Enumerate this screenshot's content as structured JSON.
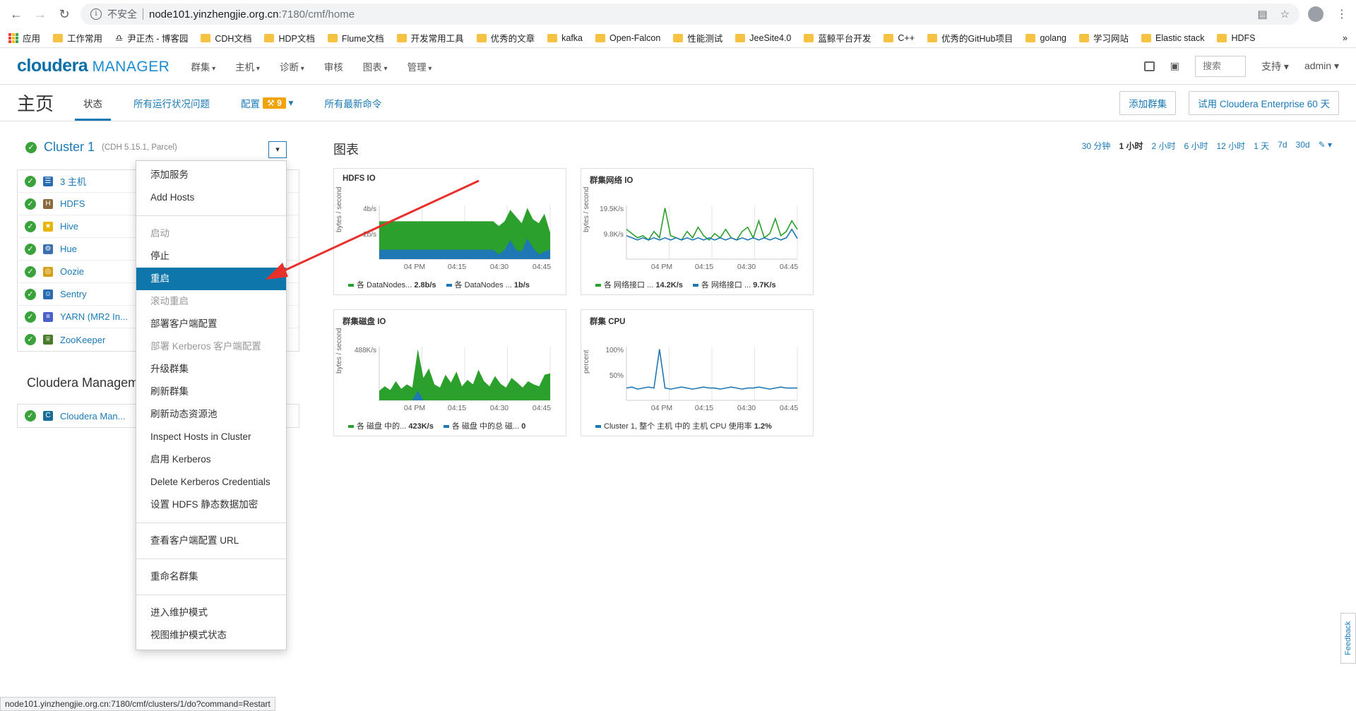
{
  "browser": {
    "insecure_label": "不安全",
    "host": "node101.yinzhengjie.org.cn",
    "path": ":7180/cmf/home",
    "bookmarks": [
      "应用",
      "工作常用",
      "尹正杰 - 博客园",
      "CDH文档",
      "HDP文档",
      "Flume文档",
      "开发常用工具",
      "优秀的文章",
      "kafka",
      "Open-Falcon",
      "性能测试",
      "JeeSite4.0",
      "蓝鲸平台开发",
      "C++",
      "优秀的GitHub项目",
      "golang",
      "学习网站",
      "Elastic stack",
      "HDFS"
    ]
  },
  "nav": {
    "logo_main": "cloudera",
    "logo_sub": "MANAGER",
    "menu": [
      "群集",
      "主机",
      "诊断",
      "审核",
      "图表",
      "管理"
    ],
    "search_placeholder": "搜索",
    "support": "支持",
    "user": "admin"
  },
  "page": {
    "title": "主页",
    "tabs": [
      "状态",
      "所有运行状况问题",
      "配置",
      "所有最新命令"
    ],
    "config_badge": "9",
    "add_cluster": "添加群集",
    "trial": "试用 Cloudera Enterprise 60 天"
  },
  "cluster": {
    "name": "Cluster 1",
    "version": "(CDH 5.15.1, Parcel)",
    "services": [
      "3 主机",
      "HDFS",
      "Hive",
      "Hue",
      "Oozie",
      "Sentry",
      "YARN (MR2 In...",
      "ZooKeeper"
    ]
  },
  "management": {
    "title": "Cloudera Managem",
    "services": [
      "Cloudera Man..."
    ]
  },
  "dropdown": {
    "groups": [
      [
        {
          "label": "添加服务",
          "state": "normal"
        },
        {
          "label": "Add Hosts",
          "state": "normal"
        }
      ],
      [
        {
          "label": "启动",
          "state": "disabled"
        },
        {
          "label": "停止",
          "state": "normal"
        },
        {
          "label": "重启",
          "state": "highlighted"
        },
        {
          "label": "滚动重启",
          "state": "disabled"
        },
        {
          "label": "部署客户端配置",
          "state": "normal"
        },
        {
          "label": "部署 Kerberos 客户端配置",
          "state": "disabled"
        },
        {
          "label": "升级群集",
          "state": "normal"
        },
        {
          "label": "刷新群集",
          "state": "normal"
        },
        {
          "label": "刷新动态资源池",
          "state": "normal"
        },
        {
          "label": "Inspect Hosts in Cluster",
          "state": "normal"
        },
        {
          "label": "启用 Kerberos",
          "state": "normal"
        },
        {
          "label": "Delete Kerberos Credentials",
          "state": "normal"
        },
        {
          "label": "设置 HDFS 静态数据加密",
          "state": "normal"
        }
      ],
      [
        {
          "label": "查看客户端配置 URL",
          "state": "normal"
        }
      ],
      [
        {
          "label": "重命名群集",
          "state": "normal"
        }
      ],
      [
        {
          "label": "进入维护模式",
          "state": "normal"
        },
        {
          "label": "视图维护模式状态",
          "state": "normal"
        }
      ]
    ]
  },
  "charts_section": {
    "title": "图表",
    "time_ranges": [
      "30 分钟",
      "1 小时",
      "2 小时",
      "6 小时",
      "12 小时",
      "1 天",
      "7d",
      "30d"
    ],
    "active_range": "1 小时"
  },
  "chart_data": [
    {
      "type": "area",
      "title": "HDFS IO",
      "ylabel": "bytes / second",
      "yticks": [
        "4b/s",
        "2b/s"
      ],
      "xticks": [
        "04 PM",
        "04:15",
        "04:30",
        "04:45"
      ],
      "series": [
        {
          "name": "各 DataNodes...",
          "color": "#2ca02c",
          "latest": "2.8b/s",
          "values": [
            4,
            4,
            4,
            4,
            4,
            4,
            4,
            4,
            4,
            4,
            4,
            4,
            4,
            4,
            4,
            4,
            4,
            4,
            4,
            4,
            4,
            3.5,
            4,
            5.2,
            4.5,
            3.8,
            5.4,
            4.2,
            3.8,
            4.8,
            2.8
          ]
        },
        {
          "name": "各 DataNodes ...",
          "color": "#1f77b4",
          "latest": "1b/s",
          "values": [
            1,
            1,
            1,
            1,
            1,
            1,
            1,
            1,
            1,
            1,
            1,
            1,
            1,
            1,
            1,
            1,
            1,
            1,
            1,
            1,
            1,
            0.5,
            1,
            2,
            1,
            0.8,
            2.2,
            1.2,
            0.5,
            0.8,
            1
          ]
        }
      ]
    },
    {
      "type": "line",
      "title": "群集网络 IO",
      "ylabel": "bytes / second",
      "yticks": [
        "19.5K/s",
        "9.8K/s"
      ],
      "xticks": [
        "04 PM",
        "04:15",
        "04:30",
        "04:45"
      ],
      "series": [
        {
          "name": "各 网络接口 ...",
          "color": "#2ca02c",
          "latest": "14.2K/s",
          "values": [
            14,
            12,
            10,
            11,
            9,
            13,
            10,
            24,
            11,
            10,
            9,
            13,
            10,
            15,
            11,
            9,
            12,
            10,
            14,
            10,
            9,
            13,
            15,
            10,
            18,
            10,
            12,
            19,
            11,
            13,
            18,
            14
          ]
        },
        {
          "name": "各 网络接口 ...",
          "color": "#1f77b4",
          "latest": "9.7K/s",
          "values": [
            11,
            10,
            9,
            10,
            9,
            10,
            9,
            10,
            9,
            10,
            9,
            10,
            9,
            10,
            9,
            10,
            9,
            10,
            9,
            10,
            9,
            10,
            9,
            10,
            9,
            10,
            9,
            10,
            9,
            10,
            14,
            9.7
          ]
        }
      ]
    },
    {
      "type": "area",
      "title": "群集磁盘 IO",
      "ylabel": "bytes / second",
      "yticks": [
        "488K/s"
      ],
      "xticks": [
        "04 PM",
        "04:15",
        "04:30",
        "04:45"
      ],
      "series": [
        {
          "name": "各 磁盘 中的...",
          "color": "#2ca02c",
          "latest": "423K/s",
          "values": [
            150,
            220,
            160,
            300,
            180,
            250,
            200,
            800,
            350,
            500,
            250,
            200,
            400,
            280,
            450,
            220,
            320,
            250,
            480,
            300,
            220,
            380,
            260,
            200,
            350,
            280,
            200,
            300,
            250,
            220,
            400,
            423
          ]
        },
        {
          "name": "各 磁盘 中的总 磁...",
          "color": "#1f77b4",
          "latest": "0",
          "values": [
            0,
            0,
            0,
            0,
            0,
            0,
            0,
            150,
            0,
            0,
            0,
            0,
            0,
            0,
            0,
            0,
            0,
            0,
            0,
            0,
            0,
            0,
            0,
            0,
            0,
            0,
            0,
            0,
            0,
            0,
            0,
            0
          ]
        }
      ]
    },
    {
      "type": "line",
      "title": "群集 CPU",
      "ylabel": "percent",
      "yticks": [
        "100%",
        "50%"
      ],
      "xticks": [
        "04 PM",
        "04:15",
        "04:30",
        "04:45"
      ],
      "series": [
        {
          "name": "Cluster 1, 整个 主机 中的 主机 CPU 使用率",
          "color": "#1f77b4",
          "latest": "1.2%",
          "values": [
            1.2,
            1.3,
            1.1,
            1.2,
            1.3,
            1.2,
            5,
            1.2,
            1.1,
            1.2,
            1.3,
            1.2,
            1.1,
            1.2,
            1.3,
            1.2,
            1.2,
            1.1,
            1.2,
            1.3,
            1.2,
            1.1,
            1.2,
            1.2,
            1.3,
            1.2,
            1.1,
            1.2,
            1.3,
            1.2,
            1.2,
            1.2
          ]
        }
      ]
    }
  ],
  "status_bar": "node101.yinzhengjie.org.cn:7180/cmf/clusters/1/do?command=Restart",
  "feedback": "Feedback",
  "colors": {
    "primary": "#1b7ab6",
    "highlight": "#0f76ab",
    "ok_green": "#3aa23a",
    "badge": "#f0a30a",
    "arrow": "#e8302a"
  }
}
